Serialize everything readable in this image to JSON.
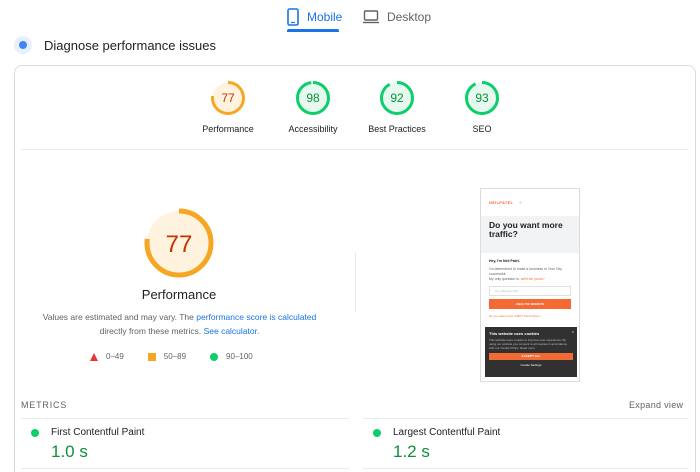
{
  "tabs": [
    {
      "label": "Mobile",
      "active": true
    },
    {
      "label": "Desktop",
      "active": false
    }
  ],
  "header": {
    "title": "Diagnose performance issues"
  },
  "scores": [
    {
      "name": "Performance",
      "value": 77,
      "status": "average"
    },
    {
      "name": "Accessibility",
      "value": 98,
      "status": "pass"
    },
    {
      "name": "Best Practices",
      "value": 92,
      "status": "pass"
    },
    {
      "name": "SEO",
      "value": 93,
      "status": "pass"
    }
  ],
  "main": {
    "score": 77,
    "label": "Performance",
    "estimate_text_1": "Values are estimated and may vary. The ",
    "estimate_link_1": "performance score is calculated",
    "estimate_text_2": " directly from these metrics. ",
    "estimate_link_2": "See calculator."
  },
  "legend": [
    {
      "range": "0–49",
      "shape": "triangle",
      "color": "#e53935"
    },
    {
      "range": "50–89",
      "shape": "square",
      "color": "#f5a623"
    },
    {
      "range": "90–100",
      "shape": "circle",
      "color": "#0cce6b"
    }
  ],
  "preview": {
    "logo": "NEILPATEL",
    "menu": "≡ ·",
    "headline": "Do you want more traffic?",
    "greeting": "Hey, I'm Neil Patel.",
    "body1": "I'm determined to make a business in Your City successful.",
    "body2": "My only question is, ",
    "body2_link": "will it be yours?",
    "input_placeholder": "Your Website URL",
    "button": "ANALYZE WEBSITE",
    "orline": "Do you want more traffic? Scroll down...",
    "cookie_title": "This website uses cookies",
    "cookie_text": "This website uses cookies to improve user experience. By using our website you consent to all cookies in accordance with our Cookie Policy. Read more",
    "cookie_button": "ACCEPT ALL",
    "cookie_settings": "Cookie Settings"
  },
  "metrics": {
    "title": "METRICS",
    "expand_label": "Expand view",
    "items": [
      {
        "name": "First Contentful Paint",
        "value": "1.0 s"
      },
      {
        "name": "Largest Contentful Paint",
        "value": "1.2 s"
      }
    ]
  },
  "colors": {
    "accent": "#1a73e8",
    "pass": "#0cce6b",
    "pass_text": "#0d8f3c",
    "average": "#f5a623",
    "average_text": "#c33300",
    "fail": "#e53935"
  }
}
